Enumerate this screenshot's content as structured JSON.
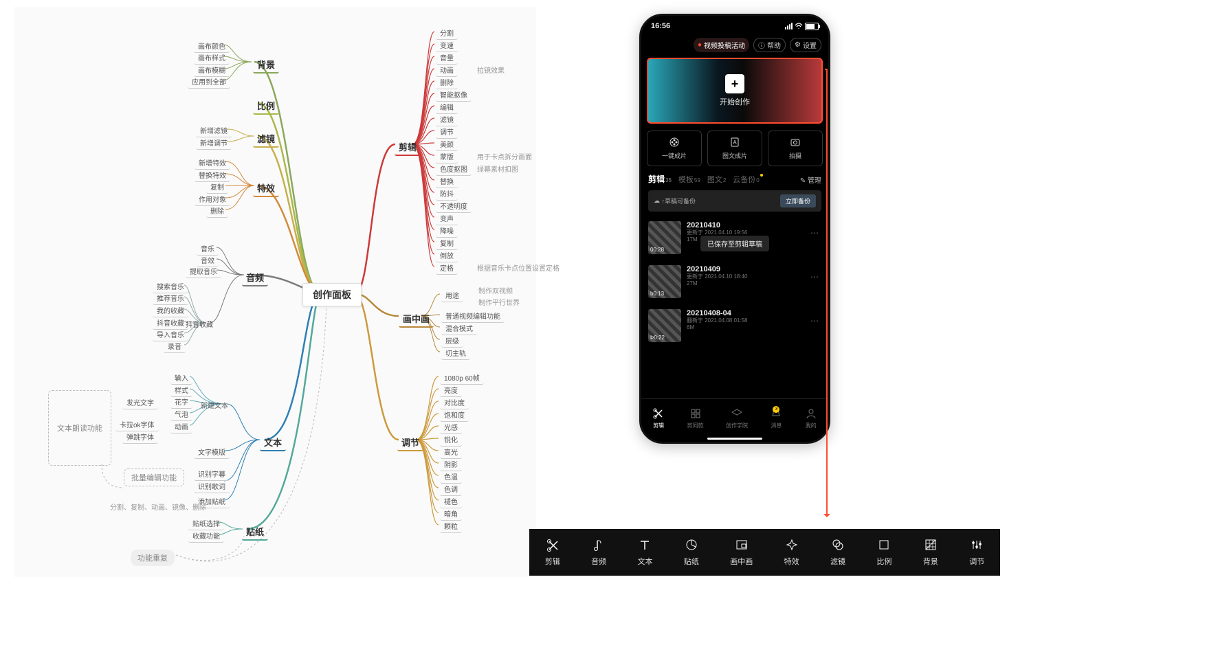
{
  "mindmap": {
    "root": "创作面板",
    "left": [
      {
        "name": "背景",
        "color": "#8aa85c",
        "leaves": [
          "画布颜色",
          "画布样式",
          "画布模糊",
          "应用到全部"
        ]
      },
      {
        "name": "比例",
        "color": "#a8b84c",
        "leaves": []
      },
      {
        "name": "滤镜",
        "color": "#c5b04c",
        "leaves": [
          "新增滤镜",
          "新增调节"
        ]
      },
      {
        "name": "特效",
        "color": "#d28a3c",
        "leaves": [
          "新增特效",
          "替换特效",
          "复制",
          "作用对象",
          "删除"
        ]
      },
      {
        "name": "音频",
        "color": "#7a7a7a",
        "sub": [
          {
            "name": "",
            "leaves": [
              "音乐",
              "音效",
              "提取音乐"
            ]
          },
          {
            "name": "抖音收藏",
            "leaves": [
              "搜索音乐",
              "推荐音乐",
              "我的收藏",
              "抖音收藏",
              "导入音乐",
              "录音"
            ]
          }
        ]
      },
      {
        "name": "文本",
        "color": "#2e7fb3",
        "sub": [
          {
            "name": "新建文本",
            "leaves": [
              "输入",
              "样式",
              "花字",
              "气泡",
              "动画"
            ],
            "extra": [
              {
                "k": "发光文字",
                "parent": "花字"
              },
              {
                "k": "卡拉ok字体",
                "parent": "动画"
              },
              {
                "k": "弹跳字体",
                "parent": "动画"
              }
            ]
          },
          {
            "name": "文字模版",
            "leaves": []
          },
          {
            "name": "",
            "leaves": [
              "识别字幕",
              "识别歌词"
            ]
          },
          {
            "name": "",
            "leaves": [
              "添加贴纸"
            ]
          }
        ],
        "callouts": [
          "文本朗读功能",
          "批量编辑功能"
        ]
      },
      {
        "name": "贴纸",
        "color": "#54a899",
        "leaves": [
          "贴纸选择",
          "收藏功能"
        ]
      }
    ],
    "right": [
      {
        "name": "剪辑",
        "color": "#cc3a3a",
        "leaves": [
          "分割",
          "变速",
          "音量",
          "动画",
          "删除",
          "智能抠像",
          "编辑",
          "滤镜",
          "调节",
          "美颜",
          "蒙版",
          "色度抠图",
          "替换",
          "防抖",
          "不透明度",
          "变声",
          "降噪",
          "复制",
          "倒放",
          "定格"
        ],
        "notes": {
          "动画": "拉镜效果",
          "蒙版": "用于卡点拆分画面",
          "色度抠图": "绿幕素材扣图",
          "定格": "根据音乐卡点位置设置定格"
        }
      },
      {
        "name": "画中画",
        "color": "#b8883c",
        "leaves": [
          "用途",
          "普通视频编辑功能",
          "混合模式",
          "层级",
          "切主轨"
        ],
        "sub_notes": {
          "用途": [
            "制作双视频",
            "制作平行世界"
          ]
        }
      },
      {
        "name": "调节",
        "color": "#cc9a3c",
        "leaves": [
          "1080p 60帧",
          "亮度",
          "对比度",
          "饱和度",
          "光感",
          "锐化",
          "高光",
          "阴影",
          "色温",
          "色调",
          "褪色",
          "暗角",
          "颗粒"
        ]
      }
    ],
    "annotations": {
      "bulk_edit": "批量编辑功能",
      "read_aloud": "文本朗读功能",
      "dup_func": "功能重复",
      "split_ops": "分割、复制、动画、镜像、删除"
    }
  },
  "phone": {
    "time": "16:56",
    "activity_pill": "视频投稿活动",
    "help": "帮助",
    "settings": "设置",
    "hero_cta": "开始创作",
    "cards": [
      {
        "label": "一键成片"
      },
      {
        "label": "图文成片"
      },
      {
        "label": "拍摄"
      }
    ],
    "tabs": [
      {
        "label": "剪辑",
        "count": "35",
        "active": true
      },
      {
        "label": "模板",
        "count": "59"
      },
      {
        "label": "图文",
        "count": "2"
      },
      {
        "label": "云备份",
        "count": "0",
        "dot": true
      }
    ],
    "manage": "管理",
    "backup": {
      "text": "↑草稿可备份",
      "btn": "立即备份"
    },
    "toast": "已保存至剪辑草稿",
    "drafts": [
      {
        "title": "20210410",
        "info": "更新于 2021.04.10 19:56",
        "size": "17M",
        "dur": "00:28"
      },
      {
        "title": "20210409",
        "info": "更新于 2021.04.10 18:40",
        "size": "27M",
        "dur": "b0:13"
      },
      {
        "title": "20210408-04",
        "info": "翻新于 2021.04.08 01:58",
        "size": "6M",
        "dur": "Þ0:22"
      }
    ],
    "tabbar": [
      {
        "label": "剪辑",
        "on": true
      },
      {
        "label": "剪同款"
      },
      {
        "label": "创作学院"
      },
      {
        "label": "消息",
        "badge": "3"
      },
      {
        "label": "我的"
      }
    ]
  },
  "toolbar": [
    {
      "label": "剪辑",
      "icon": "scissors"
    },
    {
      "label": "音频",
      "icon": "note"
    },
    {
      "label": "文本",
      "icon": "text"
    },
    {
      "label": "贴纸",
      "icon": "pie"
    },
    {
      "label": "画中画",
      "icon": "pip"
    },
    {
      "label": "特效",
      "icon": "sparkle"
    },
    {
      "label": "滤镜",
      "icon": "filter"
    },
    {
      "label": "比例",
      "icon": "square"
    },
    {
      "label": "背景",
      "icon": "hatch"
    },
    {
      "label": "调节",
      "icon": "sliders"
    }
  ]
}
